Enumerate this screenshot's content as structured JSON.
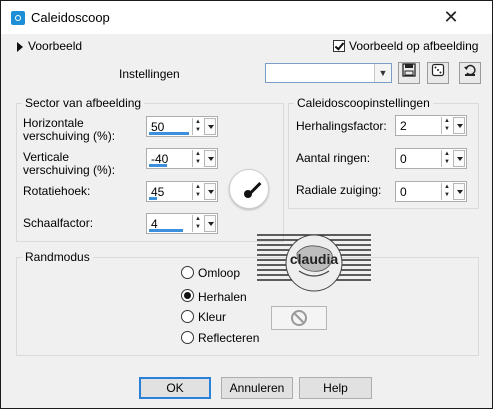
{
  "window": {
    "title": "Caleidoscoop",
    "close_glyph": "✕"
  },
  "preview": {
    "toggle_label": "Voorbeeld",
    "checkbox_label": "Voorbeeld op afbeelding",
    "checked": true
  },
  "settings": {
    "label": "Instellingen",
    "value": "",
    "save_icon": "save-icon",
    "random_icon": "dice-icon",
    "reset_icon": "reset-icon"
  },
  "sector": {
    "title": "Sector van afbeelding",
    "h_offset_label_1": "Horizontale",
    "h_offset_label_2": "verschuiving (%):",
    "h_offset": "50",
    "v_offset_label_1": "Verticale",
    "v_offset_label_2": "verschuiving (%):",
    "v_offset": "-40",
    "rotation_label": "Rotatiehoek:",
    "rotation": "45",
    "scale_label": "Schaalfactor:",
    "scale": "4"
  },
  "kaleido": {
    "title": "Caleidoscoopinstellingen",
    "repeat_label": "Herhalingsfactor:",
    "repeat": "2",
    "rings_label": "Aantal ringen:",
    "rings": "0",
    "radial_label": "Radiale zuiging:",
    "radial": "0"
  },
  "edge": {
    "title": "Randmodus",
    "options": [
      "Omloop",
      "Herhalen",
      "Kleur",
      "Reflecteren"
    ],
    "selected": "Herhalen"
  },
  "buttons": {
    "ok": "OK",
    "cancel": "Annuleren",
    "help": "Help"
  },
  "colors": {
    "accent": "#3c8fdc",
    "focus": "#2a7fd6",
    "title_icon": "#1e8fd6"
  }
}
